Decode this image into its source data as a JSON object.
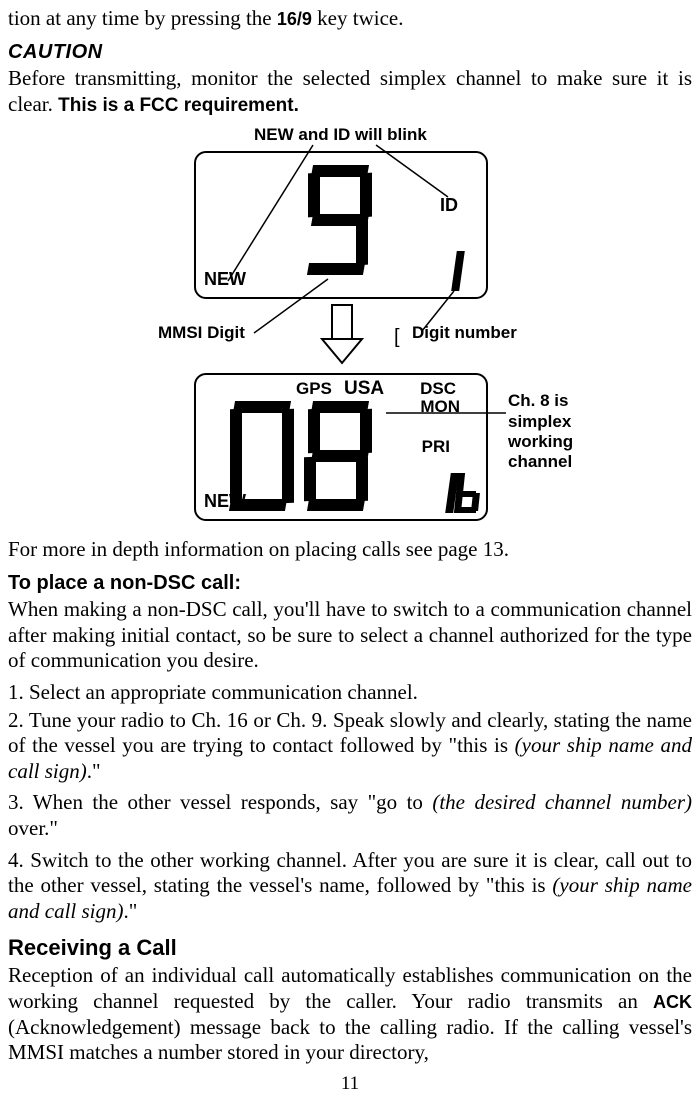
{
  "frag_top": "tion at any time by pressing the ",
  "frag_top_key": "16/9",
  "frag_top_end": " key twice.",
  "caution": "CAUTION",
  "caution_body_a": "Before transmitting, monitor the selected simplex channel to make sure it is clear. ",
  "caution_body_b": "This is a FCC requirement.",
  "fig": {
    "title_top": "NEW and ID will blink",
    "label_mmsi": "MMSI Digit",
    "label_digitnum": "Digit number",
    "lcd1": {
      "new": "NEW",
      "id": "ID"
    },
    "lcd2": {
      "new": "NEW",
      "gps": "GPS",
      "usa": "USA",
      "dsc": "DSC",
      "mon": "MON",
      "pri": "PRI"
    },
    "callout_right": "Ch. 8 is simplex working channel",
    "bracket": "["
  },
  "more_info": "For more in depth information on placing calls see page 13.",
  "nondsc_head": "To place a non-DSC call:",
  "nondsc_intro": "When making a non-DSC call, you'll have to switch to a communication channel after making initial contact, so be sure to select a channel authorized for the type of communication you desire.",
  "step1": "1. Select an appropriate communication channel.",
  "step2a": "2. Tune your radio to Ch. 16 or Ch. 9. Speak slowly and clearly, stating the name of the vessel you are trying to contact followed by \"this is ",
  "step2b": "(your ship name and call sign)",
  "step2c": ".\"",
  "step3a": "3. When the other vessel responds, say \"go to ",
  "step3b": "(the desired channel number)",
  "step3c": " over.\"",
  "step4a": "4. Switch to the other working channel. After you are sure it is clear, call out to the other vessel, stating the vessel's name, followed by \"this is ",
  "step4b": "(your ship name and call sign)",
  "step4c": ".\"",
  "recv_head": "Receiving a Call",
  "recv_a": "Reception of an individual call automatically establishes communication on the working channel requested by the caller. Your radio transmits an ",
  "recv_ack": "ACK",
  "recv_b": " (Acknowledgement) message back to the calling radio. If the calling vessel's MMSI matches a number stored in your directory,",
  "pagenum": "11"
}
